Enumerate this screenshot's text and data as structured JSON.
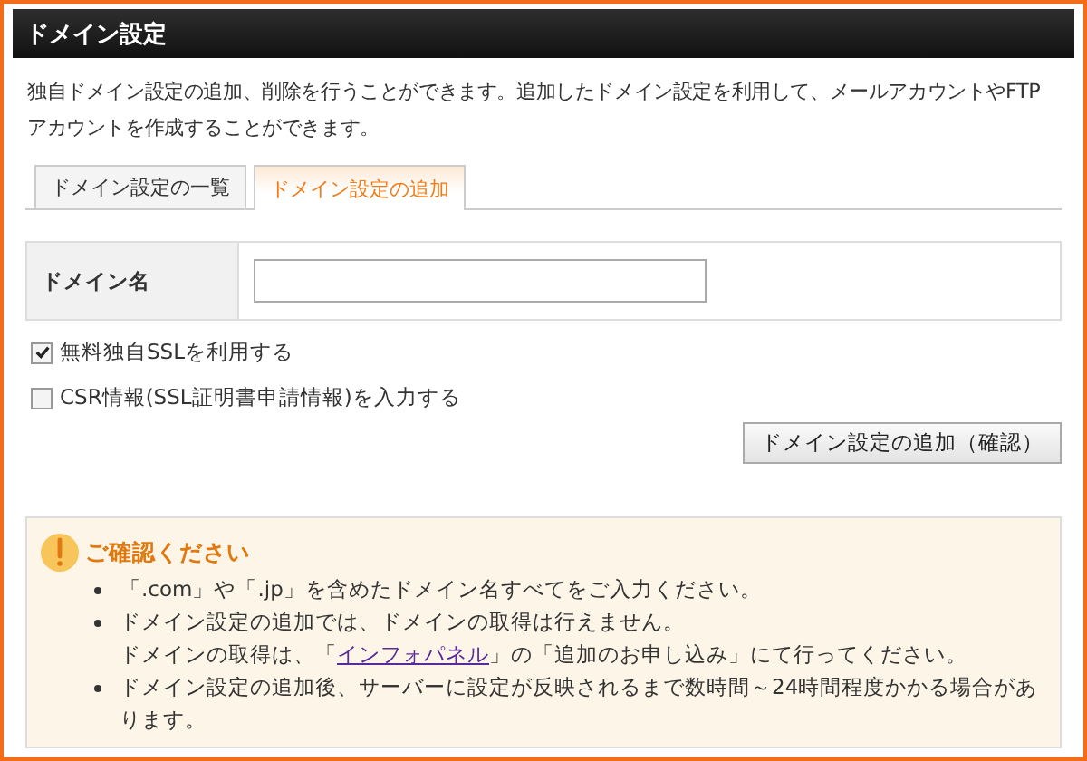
{
  "header": {
    "title": "ドメイン設定"
  },
  "description": "独自ドメイン設定の追加、削除を行うことができます。追加したドメイン設定を利用して、メールアカウントやFTPアカウントを作成することができます。",
  "tabs": [
    {
      "label": "ドメイン設定の一覧",
      "selected": false
    },
    {
      "label": "ドメイン設定の追加",
      "selected": true
    }
  ],
  "form": {
    "field_label": "ドメイン名"
  },
  "options": [
    {
      "label": "無料独自SSLを利用する",
      "checked": true
    },
    {
      "label": "CSR情報(SSL証明書申請情報)を入力する",
      "checked": false
    }
  ],
  "submit_button": "ドメイン設定の追加（確認）",
  "notice": {
    "title": "ご確認ください",
    "items": [
      {
        "lines": [
          [
            {
              "text": "「.com」や「.jp」を含めたドメイン名すべてをご入力ください。",
              "link": false
            }
          ]
        ]
      },
      {
        "lines": [
          [
            {
              "text": "ドメイン設定の追加では、ドメインの取得は行えません。",
              "link": false
            }
          ],
          [
            {
              "text": "ドメインの取得は、「",
              "link": false
            },
            {
              "text": "インフォパネル",
              "link": true
            },
            {
              "text": "」の「追加のお申し込み」にて行ってください。",
              "link": false
            }
          ]
        ]
      },
      {
        "lines": [
          [
            {
              "text": "ドメイン設定の追加後、サーバーに設定が反映されるまで数時間～24時間程度かかる場合があります。",
              "link": false
            }
          ]
        ]
      }
    ]
  }
}
